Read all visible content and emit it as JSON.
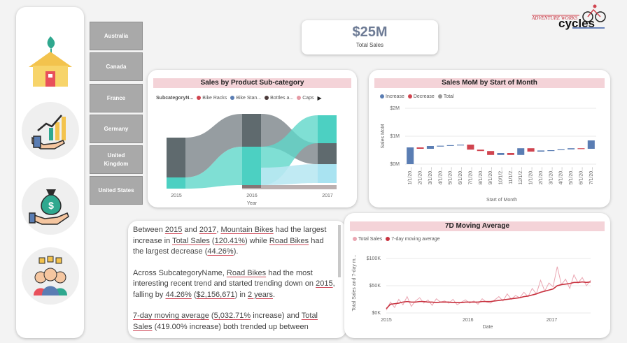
{
  "kpi": {
    "value": "$25M",
    "label": "Total Sales"
  },
  "logo": {
    "tagline": "ADVENTURE WORKS",
    "brand": "cycles"
  },
  "nav": {
    "icons": [
      "home-icon",
      "growth-chart-icon",
      "money-bag-icon",
      "team-icon"
    ]
  },
  "countries": [
    "Australia",
    "Canada",
    "France",
    "Germany",
    "United\nKingdom",
    "United States"
  ],
  "subcat_chart": {
    "title": "Sales by Product Sub-category",
    "legend_label": "SubcategoryN...",
    "legend_items": [
      {
        "name": "Bike Racks",
        "color": "#d0444f"
      },
      {
        "name": "Bike Stan...",
        "color": "#5a7db3"
      },
      {
        "name": "Bottles a...",
        "color": "#4b3a3a"
      },
      {
        "name": "Caps",
        "color": "#e69aa5"
      }
    ],
    "x_labels": [
      "2015",
      "2016",
      "2017"
    ],
    "xlabel": "Year"
  },
  "mom_chart": {
    "title": "Sales MoM by Start of Month",
    "legend_items": [
      {
        "name": "Increase",
        "color": "#5a7db3"
      },
      {
        "name": "Decrease",
        "color": "#d0444f"
      },
      {
        "name": "Total",
        "color": "#9a9a9a"
      }
    ],
    "xlabel": "Start of Month",
    "ylabel": "Sales MoM"
  },
  "ma_chart": {
    "title": "7D Moving Average",
    "legend_items": [
      {
        "name": "Total Sales",
        "color": "#eaa6b2"
      },
      {
        "name": "7-day moving average",
        "color": "#c8323f"
      }
    ],
    "xlabel": "Date",
    "ylabel": "Total Sales and 7-day m..."
  },
  "chart_data": [
    {
      "type": "bar",
      "title": "Sales MoM by Start of Month",
      "categories": [
        "1/1/20...",
        "2/1/20...",
        "3/1/20...",
        "4/1/20...",
        "5/1/20...",
        "6/1/20...",
        "7/1/20...",
        "8/1/20...",
        "9/1/20...",
        "10/1/2...",
        "11/1/2...",
        "12/1/2...",
        "1/1/20...",
        "2/1/20...",
        "3/1/20...",
        "4/1/20...",
        "5/1/20...",
        "6/1/20...",
        "7/1/20..."
      ],
      "y_ticks": [
        "$0M",
        "$1M",
        "$2M"
      ],
      "ylim": [
        0,
        2
      ],
      "waterfall": [
        {
          "from": 0.6,
          "to": 0.0,
          "kind": "increase"
        },
        {
          "from": 0.6,
          "to": 0.55,
          "kind": "decrease"
        },
        {
          "from": 0.55,
          "to": 0.65,
          "kind": "increase"
        },
        {
          "from": 0.65,
          "to": 0.66,
          "kind": "increase"
        },
        {
          "from": 0.66,
          "to": 0.68,
          "kind": "increase"
        },
        {
          "from": 0.68,
          "to": 0.7,
          "kind": "increase"
        },
        {
          "from": 0.7,
          "to": 0.52,
          "kind": "decrease"
        },
        {
          "from": 0.52,
          "to": 0.47,
          "kind": "decrease"
        },
        {
          "from": 0.47,
          "to": 0.33,
          "kind": "decrease"
        },
        {
          "from": 0.33,
          "to": 0.4,
          "kind": "increase"
        },
        {
          "from": 0.4,
          "to": 0.33,
          "kind": "decrease"
        },
        {
          "from": 0.33,
          "to": 0.57,
          "kind": "increase"
        },
        {
          "from": 0.57,
          "to": 0.45,
          "kind": "decrease"
        },
        {
          "from": 0.45,
          "to": 0.49,
          "kind": "increase"
        },
        {
          "from": 0.49,
          "to": 0.5,
          "kind": "increase"
        },
        {
          "from": 0.5,
          "to": 0.53,
          "kind": "increase"
        },
        {
          "from": 0.53,
          "to": 0.57,
          "kind": "increase"
        },
        {
          "from": 0.57,
          "to": 0.55,
          "kind": "decrease"
        },
        {
          "from": 0.55,
          "to": 0.85,
          "kind": "increase"
        }
      ]
    },
    {
      "type": "line",
      "title": "7D Moving Average",
      "x_ticks": [
        "2015",
        "2016",
        "2017"
      ],
      "y_ticks": [
        "$0K",
        "$50K",
        "$100K"
      ],
      "ylim": [
        0,
        100
      ],
      "series": [
        {
          "name": "Total Sales",
          "values": [
            5,
            20,
            10,
            25,
            15,
            30,
            12,
            22,
            28,
            18,
            24,
            14,
            26,
            20,
            22,
            18,
            25,
            15,
            20,
            24,
            18,
            22,
            16,
            26,
            20,
            18,
            24,
            30,
            22,
            35,
            25,
            32,
            28,
            38,
            30,
            45,
            35,
            60,
            40,
            55,
            48,
            85,
            52,
            62,
            45,
            70,
            55,
            65,
            50,
            60
          ]
        },
        {
          "name": "7-day moving average",
          "values": [
            8,
            16,
            17,
            18,
            20,
            21,
            20,
            20,
            21,
            21,
            20,
            20,
            19,
            20,
            20,
            20,
            19,
            19,
            19,
            20,
            20,
            20,
            20,
            21,
            21,
            21,
            22,
            23,
            24,
            25,
            26,
            27,
            28,
            30,
            31,
            33,
            35,
            38,
            40,
            42,
            44,
            50,
            52,
            53,
            54,
            56,
            56,
            57,
            56,
            57
          ]
        }
      ]
    }
  ],
  "narrative": {
    "p1_a": "Between ",
    "p1_2015": "2015",
    "p1_b": " and ",
    "p1_2017": "2017",
    "p1_c": ", ",
    "p1_mtb": "Mountain Bikes",
    "p1_d": " had the largest increase in ",
    "p1_ts": "Total Sales",
    "p1_e": " (",
    "p1_pct": "120.41%",
    "p1_f": ") while ",
    "p1_rb": "Road Bikes",
    "p1_g": " had the largest decrease (",
    "p1_pct2": "44.26%",
    "p1_h": ").",
    "p2_a": "Across SubcategoryName, ",
    "p2_rb": "Road Bikes",
    "p2_b": " had the most interesting recent trend and started trending down on ",
    "p2_2015": "2015",
    "p2_c": ", falling by ",
    "p2_pct": "44.26%",
    "p2_d": " (",
    "p2_amt": "$2,156,671",
    "p2_e": ") in ",
    "p2_yrs": "2 years",
    "p2_f": ".",
    "p3_ma": "7-day moving average",
    "p3_a": " (",
    "p3_pct": "5,032.71%",
    "p3_b": " increase) and ",
    "p3_ts": "Total Sales",
    "p3_c": " (419.00% increase) both trended up between"
  }
}
